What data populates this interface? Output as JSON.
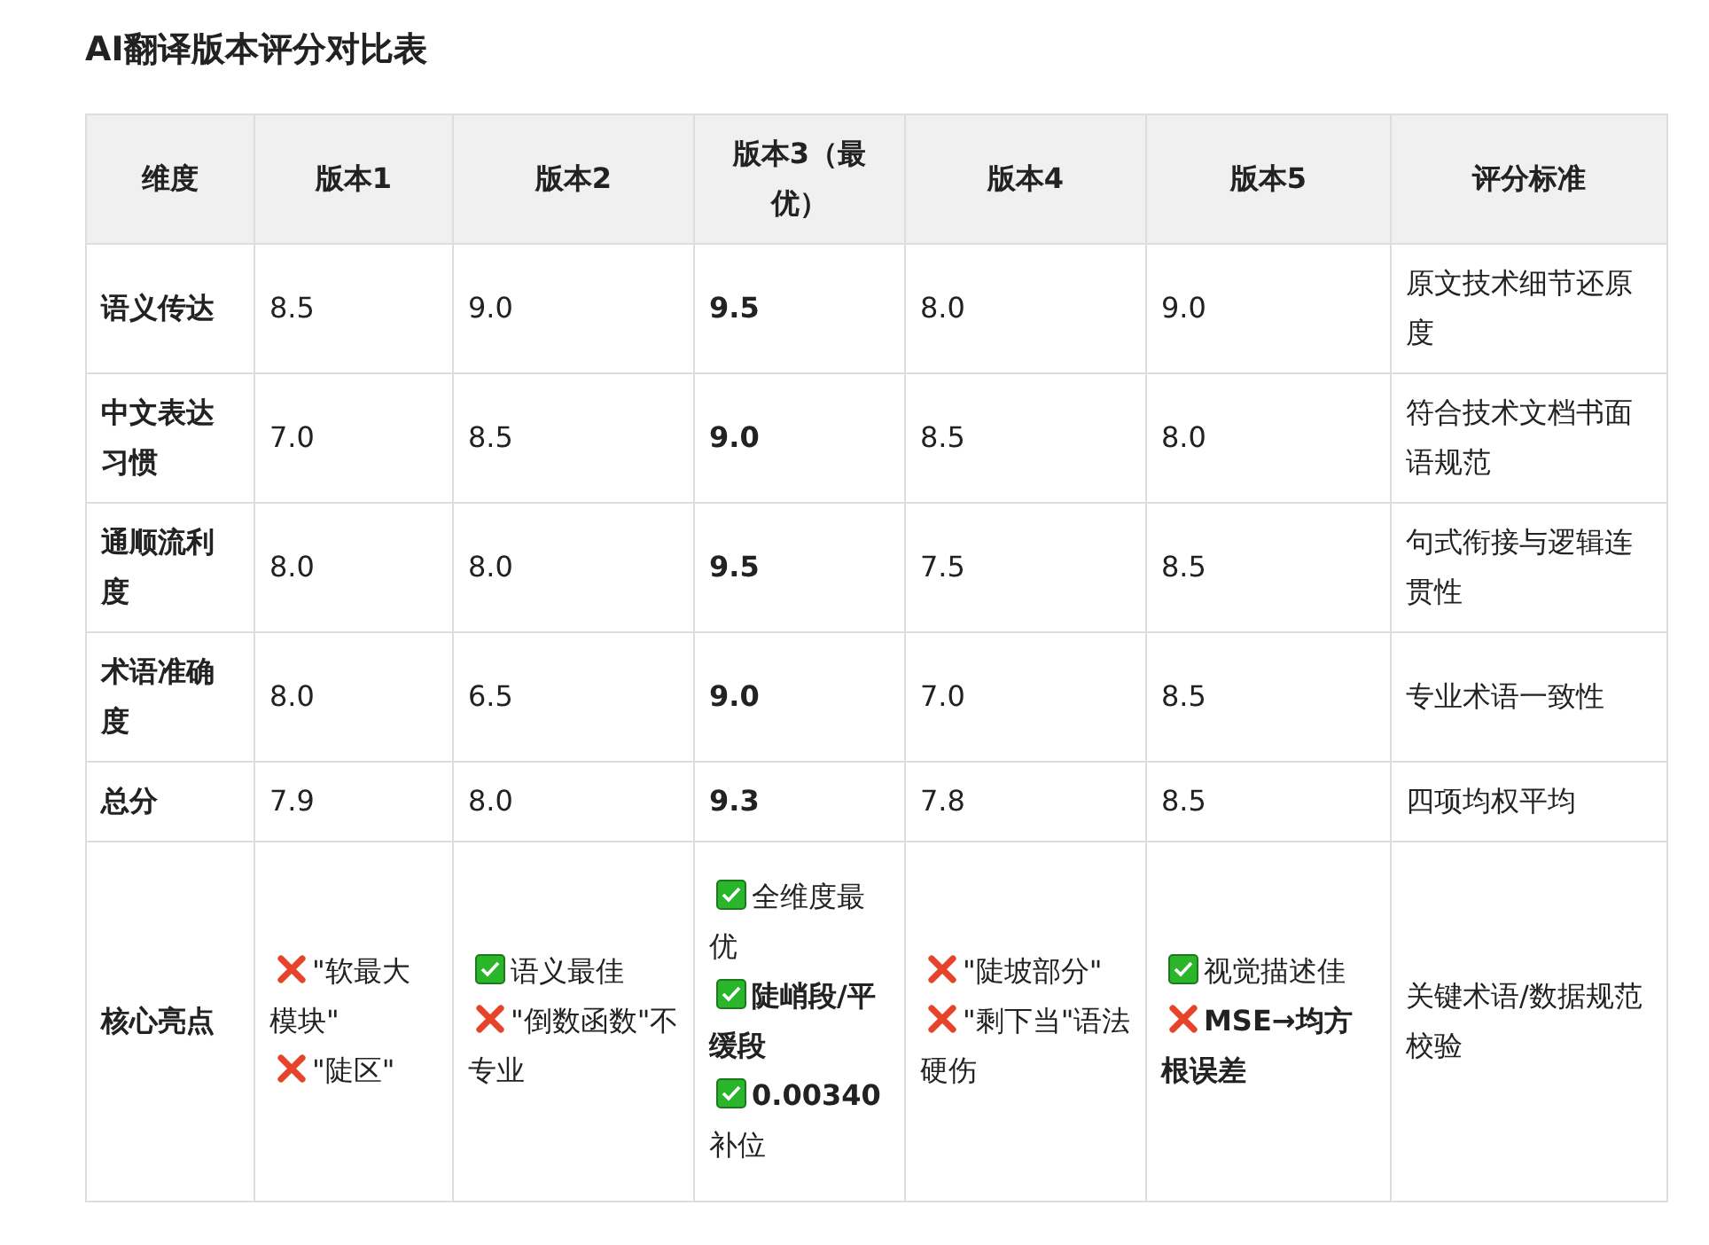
{
  "title": "AI翻译版本评分对比表",
  "table": {
    "columns": [
      "维度",
      "版本1",
      "版本2",
      "版本3（最优）",
      "版本4",
      "版本5",
      "评分标准"
    ],
    "rows": [
      {
        "dimension": "语义传达",
        "scores": [
          {
            "text": "8.5",
            "best": false
          },
          {
            "text": "9.0",
            "best": false
          },
          {
            "text": "9.5",
            "best": true
          },
          {
            "text": "8.0",
            "best": false
          },
          {
            "text": "9.0",
            "best": false
          }
        ],
        "criterion": "原文技术细节还原度"
      },
      {
        "dimension": "中文表达习惯",
        "scores": [
          {
            "text": "7.0",
            "best": false
          },
          {
            "text": "8.5",
            "best": false
          },
          {
            "text": "9.0",
            "best": true
          },
          {
            "text": "8.5",
            "best": false
          },
          {
            "text": "8.0",
            "best": false
          }
        ],
        "criterion": "符合技术文档书面语规范"
      },
      {
        "dimension": "通顺流利度",
        "scores": [
          {
            "text": "8.0",
            "best": false
          },
          {
            "text": "8.0",
            "best": false
          },
          {
            "text": "9.5",
            "best": true
          },
          {
            "text": "7.5",
            "best": false
          },
          {
            "text": "8.5",
            "best": false
          }
        ],
        "criterion": "句式衔接与逻辑连贯性"
      },
      {
        "dimension": "术语准确度",
        "scores": [
          {
            "text": "8.0",
            "best": false
          },
          {
            "text": "6.5",
            "best": false
          },
          {
            "text": "9.0",
            "best": true
          },
          {
            "text": "7.0",
            "best": false
          },
          {
            "text": "8.5",
            "best": false
          }
        ],
        "criterion": "专业术语一致性"
      },
      {
        "dimension": "总分",
        "scores": [
          {
            "text": "7.9",
            "best": false
          },
          {
            "text": "8.0",
            "best": false
          },
          {
            "text": "9.3",
            "best": true
          },
          {
            "text": "7.8",
            "best": false
          },
          {
            "text": "8.5",
            "best": false
          }
        ],
        "criterion": "四项均权平均"
      }
    ],
    "highlights_row": {
      "dimension": "核心亮点",
      "cells": [
        [
          {
            "kind": "bad",
            "text": "\"软最大模块\""
          },
          {
            "kind": "bad",
            "text": "\"陡区\""
          }
        ],
        [
          {
            "kind": "good",
            "text": "语义最佳"
          },
          {
            "kind": "bad",
            "text": "\"倒数函数\"不专业"
          }
        ],
        [
          {
            "kind": "good",
            "text": "全维度最优"
          },
          {
            "kind": "good",
            "text": "**陡峭段/平缓段**"
          },
          {
            "kind": "good",
            "text": "**0.00340** 补位"
          }
        ],
        [
          {
            "kind": "bad",
            "text": "\"陡坡部分\""
          },
          {
            "kind": "bad",
            "text": "\"剩下当\"语法硬伤"
          }
        ],
        [
          {
            "kind": "good",
            "text": "视觉描述佳"
          },
          {
            "kind": "bad",
            "text": "**MSE→均方根误差**"
          }
        ]
      ],
      "criterion": "关键术语/数据规范校验"
    }
  }
}
